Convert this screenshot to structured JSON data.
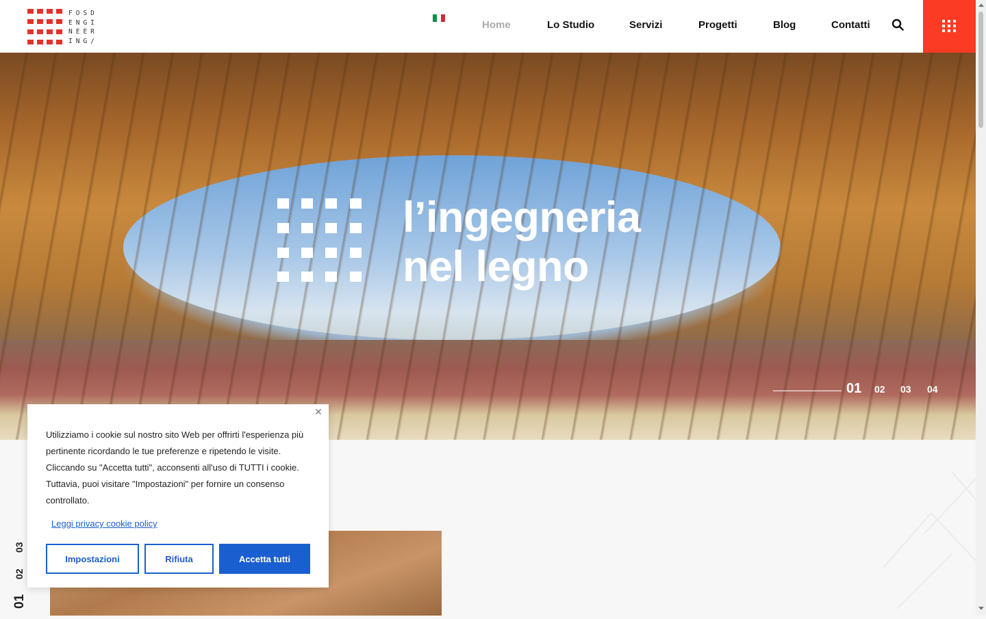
{
  "header": {
    "logo_text": [
      "FOSD",
      "ENGI",
      "NEER",
      "ING/"
    ],
    "flag_colors": [
      "#009246",
      "#ffffff",
      "#ce2b37"
    ],
    "nav": [
      {
        "label": "Home",
        "active": true
      },
      {
        "label": "Lo Studio",
        "active": false
      },
      {
        "label": "Servizi",
        "active": false
      },
      {
        "label": "Progetti",
        "active": false
      },
      {
        "label": "Blog",
        "active": false
      },
      {
        "label": "Contatti",
        "active": false
      }
    ],
    "search_icon": "search-icon",
    "menu_icon": "grid-menu-icon",
    "accent_color": "#fc3b24"
  },
  "hero": {
    "title_line1": "l’ingegneria",
    "title_line2": "nel legno",
    "slides": [
      "01",
      "02",
      "03",
      "04"
    ],
    "current_slide": "01"
  },
  "side_nav": [
    "01",
    "02",
    "03"
  ],
  "cookie": {
    "text": "Utilizziamo i cookie sul nostro sito Web per offrirti l'esperienza più pertinente ricordando le tue preferenze e ripetendo le visite. Cliccando su \"Accetta tutti\", acconsenti all'uso di TUTTI i cookie. Tuttavia, puoi visitare \"Impostazioni\" per fornire un consenso controllato.",
    "link": "Leggi privacy cookie policy",
    "btn_settings": "Impostazioni",
    "btn_reject": "Rifiuta",
    "btn_accept": "Accetta tutti",
    "button_color": "#1a5fcf"
  }
}
